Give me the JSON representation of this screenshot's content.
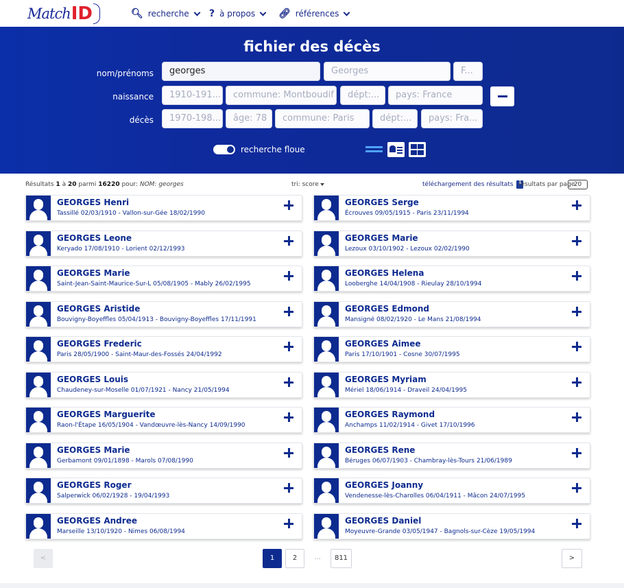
{
  "nav": {
    "logo_script": "Match",
    "logo_id": "ID",
    "items": [
      {
        "icon": "search-icon",
        "label": "recherche"
      },
      {
        "icon": "question-icon",
        "label": "à propos"
      },
      {
        "icon": "link-icon",
        "label": "références"
      }
    ]
  },
  "search": {
    "title": "fichier des décès",
    "labels": {
      "name": "nom/prénoms",
      "birth": "naissance",
      "death": "décès"
    },
    "name_value": "georges",
    "firstname_placeholder": "Georges",
    "sex_placeholder": "F...",
    "birth_date_placeholder": "1910-191...",
    "birth_city_placeholder": "commune: Montboudif",
    "birth_dept_placeholder": "dépt:...",
    "birth_country_placeholder": "pays: France",
    "death_date_placeholder": "1970-198...",
    "death_age_placeholder": "âge: 78",
    "death_city_placeholder": "commune: Paris",
    "death_dept_placeholder": "dépt:...",
    "death_country_placeholder": "pays: Fra...",
    "fuzzy_label": "recherche floue",
    "fuzzy_on": true
  },
  "meta": {
    "prefix": "Résultats",
    "from": "1",
    "to_word": "à",
    "to": "20",
    "among": "parmi",
    "total": "16220",
    "for": "pour:",
    "query": "NOM: georges",
    "sort": "tri: score",
    "download": "téléchargement des résultats",
    "per_page_label": "résultats par page",
    "per_page": "20"
  },
  "results_left": [
    {
      "name": "GEORGES Henri",
      "dates": "Tassillé 02/03/1910   -   Vallon-sur-Gée 18/02/1990"
    },
    {
      "name": "GEORGES Leone",
      "dates": "Keryado 17/08/1910   -   Lorient 02/12/1993"
    },
    {
      "name": "GEORGES Marie",
      "dates": "Saint-Jean-Saint-Maurice-Sur-L 05/08/1905   -   Mably 26/02/1995"
    },
    {
      "name": "GEORGES Aristide",
      "dates": "Bouvigny-Boyeffles 05/04/1913   -   Bouvigny-Boyeffles 17/11/1991"
    },
    {
      "name": "GEORGES Frederic",
      "dates": "Paris 28/05/1900   -   Saint-Maur-des-Fossés 24/04/1992"
    },
    {
      "name": "GEORGES Louis",
      "dates": "Chaudeney-sur-Moselle 01/07/1921   -   Nancy 21/05/1994"
    },
    {
      "name": "GEORGES Marguerite",
      "dates": "Raon-l'Étape 16/05/1904   -   Vandœuvre-lès-Nancy 14/09/1990"
    },
    {
      "name": "GEORGES Marie",
      "dates": "Gerbamont 09/01/1898   -   Marols 07/08/1990"
    },
    {
      "name": "GEORGES Roger",
      "dates": "Salperwick 06/02/1928   -   19/04/1993"
    },
    {
      "name": "GEORGES Andree",
      "dates": "Marseille 13/10/1920   -   Nimes 06/08/1994"
    }
  ],
  "results_right": [
    {
      "name": "GEORGES Serge",
      "dates": "Écrouves 09/05/1915   -   Paris 23/11/1994"
    },
    {
      "name": "GEORGES Marie",
      "dates": "Lezoux 03/10/1902   -   Lezoux 02/02/1990"
    },
    {
      "name": "GEORGES Helena",
      "dates": "Looberghe 14/04/1908   -   Rieulay 28/10/1994"
    },
    {
      "name": "GEORGES Edmond",
      "dates": "Mansigné 08/02/1920   -   Le Mans 21/08/1994"
    },
    {
      "name": "GEORGES Aimee",
      "dates": "Paris 17/10/1901   -   Cosne 30/07/1995"
    },
    {
      "name": "GEORGES Myriam",
      "dates": "Mériel 18/06/1914   -   Draveil 24/04/1995"
    },
    {
      "name": "GEORGES Raymond",
      "dates": "Anchamps 11/02/1914   -   Givet 17/10/1996"
    },
    {
      "name": "GEORGES Rene",
      "dates": "Béruges 06/07/1903   -   Chambray-lès-Tours 21/06/1989"
    },
    {
      "name": "GEORGES Joanny",
      "dates": "Vendenesse-lès-Charolles 06/04/1911   -   Mâcon 24/07/1995"
    },
    {
      "name": "GEORGES Daniel",
      "dates": "Moyeuvre-Grande 03/05/1947   -   Bagnols-sur-Cèze 19/05/1994"
    }
  ],
  "pagination": {
    "prev": "<",
    "pages": [
      "1",
      "2"
    ],
    "ellipsis": "...",
    "last": "811",
    "next": ">",
    "current": "1"
  }
}
